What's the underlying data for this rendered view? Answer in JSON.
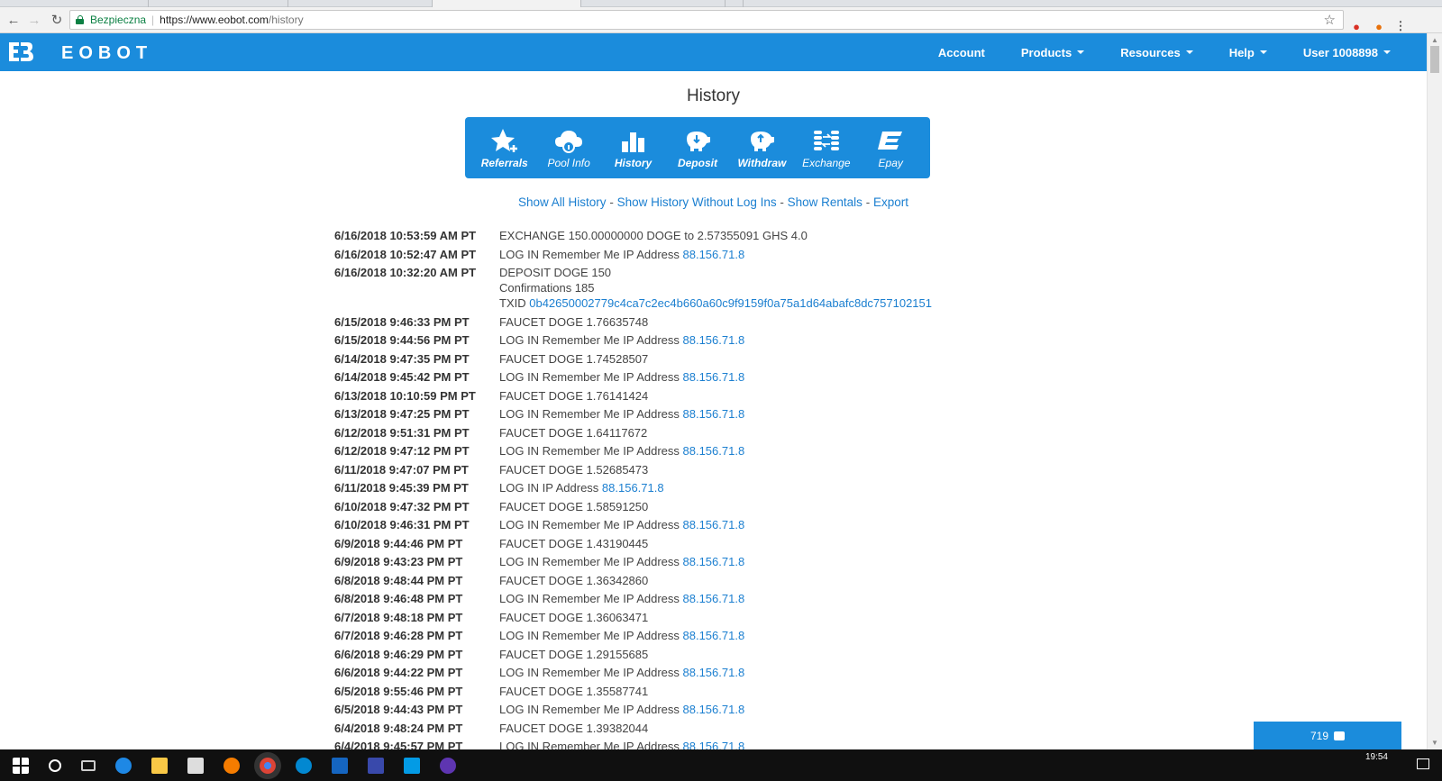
{
  "browser": {
    "secure_label": "Bezpieczna",
    "url_host": "https://www.eobot.com",
    "url_path": "/history"
  },
  "nav": {
    "brand": "EOBOT",
    "items": [
      {
        "label": "Account",
        "dropdown": false
      },
      {
        "label": "Products",
        "dropdown": true
      },
      {
        "label": "Resources",
        "dropdown": true
      },
      {
        "label": "Help",
        "dropdown": true
      },
      {
        "label": "User 1008898",
        "dropdown": true
      }
    ]
  },
  "page": {
    "title": "History"
  },
  "iconbar": {
    "referrals": "Referrals",
    "pool_info": "Pool Info",
    "history": "History",
    "deposit": "Deposit",
    "withdraw": "Withdraw",
    "exchange": "Exchange",
    "epay": "Epay"
  },
  "links": {
    "show_all": "Show All History",
    "without_logins": "Show History Without Log Ins",
    "rentals": "Show Rentals",
    "export": "Export",
    "separator": " - "
  },
  "history": [
    {
      "date": "6/16/2018 10:53:59 AM PT",
      "text": "EXCHANGE 150.00000000 DOGE to 2.57355091 GHS 4.0"
    },
    {
      "date": "6/16/2018 10:52:47 AM PT",
      "text": "LOG IN Remember Me IP Address ",
      "link": "88.156.71.8"
    },
    {
      "date": "6/16/2018 10:32:20 AM PT",
      "text": "DEPOSIT DOGE 150",
      "line2": "Confirmations 185",
      "line3": "TXID ",
      "txid": "0b42650002779c4ca7c2ec4b660a60c9f9159f0a75a1d64abafc8dc757102151"
    },
    {
      "date": "6/15/2018 9:46:33 PM PT",
      "text": "FAUCET DOGE 1.76635748"
    },
    {
      "date": "6/15/2018 9:44:56 PM PT",
      "text": "LOG IN Remember Me IP Address ",
      "link": "88.156.71.8"
    },
    {
      "date": "6/14/2018 9:47:35 PM PT",
      "text": "FAUCET DOGE 1.74528507"
    },
    {
      "date": "6/14/2018 9:45:42 PM PT",
      "text": "LOG IN Remember Me IP Address ",
      "link": "88.156.71.8"
    },
    {
      "date": "6/13/2018 10:10:59 PM PT",
      "text": "FAUCET DOGE 1.76141424"
    },
    {
      "date": "6/13/2018 9:47:25 PM PT",
      "text": "LOG IN Remember Me IP Address ",
      "link": "88.156.71.8"
    },
    {
      "date": "6/12/2018 9:51:31 PM PT",
      "text": "FAUCET DOGE 1.64117672"
    },
    {
      "date": "6/12/2018 9:47:12 PM PT",
      "text": "LOG IN Remember Me IP Address ",
      "link": "88.156.71.8"
    },
    {
      "date": "6/11/2018 9:47:07 PM PT",
      "text": "FAUCET DOGE 1.52685473"
    },
    {
      "date": "6/11/2018 9:45:39 PM PT",
      "text": "LOG IN IP Address ",
      "link": "88.156.71.8"
    },
    {
      "date": "6/10/2018 9:47:32 PM PT",
      "text": "FAUCET DOGE 1.58591250"
    },
    {
      "date": "6/10/2018 9:46:31 PM PT",
      "text": "LOG IN Remember Me IP Address ",
      "link": "88.156.71.8"
    },
    {
      "date": "6/9/2018 9:44:46 PM PT",
      "text": "FAUCET DOGE 1.43190445"
    },
    {
      "date": "6/9/2018 9:43:23 PM PT",
      "text": "LOG IN Remember Me IP Address ",
      "link": "88.156.71.8"
    },
    {
      "date": "6/8/2018 9:48:44 PM PT",
      "text": "FAUCET DOGE 1.36342860"
    },
    {
      "date": "6/8/2018 9:46:48 PM PT",
      "text": "LOG IN Remember Me IP Address ",
      "link": "88.156.71.8"
    },
    {
      "date": "6/7/2018 9:48:18 PM PT",
      "text": "FAUCET DOGE 1.36063471"
    },
    {
      "date": "6/7/2018 9:46:28 PM PT",
      "text": "LOG IN Remember Me IP Address ",
      "link": "88.156.71.8"
    },
    {
      "date": "6/6/2018 9:46:29 PM PT",
      "text": "FAUCET DOGE 1.29155685"
    },
    {
      "date": "6/6/2018 9:44:22 PM PT",
      "text": "LOG IN Remember Me IP Address ",
      "link": "88.156.71.8"
    },
    {
      "date": "6/5/2018 9:55:46 PM PT",
      "text": "FAUCET DOGE 1.35587741"
    },
    {
      "date": "6/5/2018 9:44:43 PM PT",
      "text": "LOG IN Remember Me IP Address ",
      "link": "88.156.71.8"
    },
    {
      "date": "6/4/2018 9:48:24 PM PT",
      "text": "FAUCET DOGE 1.39382044"
    },
    {
      "date": "6/4/2018 9:45:57 PM PT",
      "text": "LOG IN Remember Me IP Address ",
      "link": "88.156.71.8"
    }
  ],
  "chat": {
    "count": "719"
  },
  "taskbar": {
    "time": "19:54"
  },
  "colors": {
    "brand": "#1b8cdc",
    "link": "#1b7fd0",
    "secure": "#0b8043"
  }
}
